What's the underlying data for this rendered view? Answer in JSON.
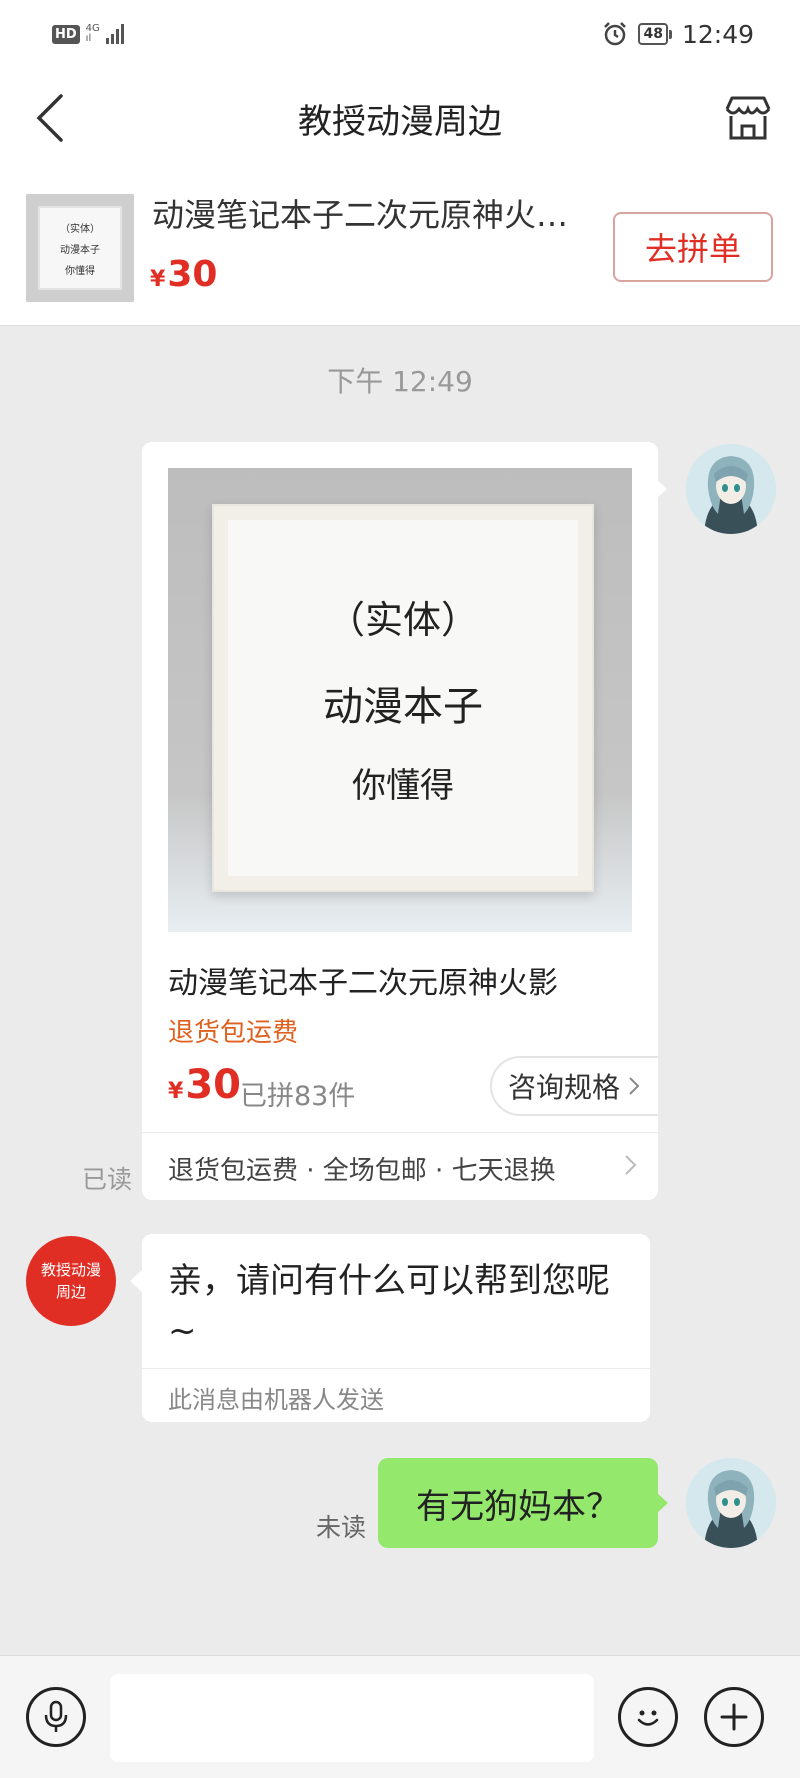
{
  "status_bar": {
    "hd": "HD",
    "network": "4G",
    "battery": "48",
    "time": "12:49"
  },
  "nav": {
    "title": "教授动漫周边"
  },
  "product_strip": {
    "title": "动漫笔记本子二次元原神火…",
    "currency": "¥",
    "price": "30",
    "button_label": "去拼单",
    "thumb_lines": [
      "（实体）",
      "动漫本子",
      "你懂得"
    ]
  },
  "chat": {
    "timestamp": "下午 12:49",
    "product_card": {
      "image_lines": [
        "（实体）",
        "动漫本子",
        "你懂得"
      ],
      "title": "动漫笔记本子二次元原神火影",
      "promo": "退货包运费",
      "currency": "¥",
      "price": "30",
      "sold": "已拼83件",
      "consult_label": "咨询规格",
      "services": "退货包运费 · 全场包邮 · 七天退换"
    },
    "read_status": "已读",
    "shop_avatar_text": "教授动漫周边",
    "bot_message": {
      "text": "亲，请问有什么可以帮到您呢~",
      "footnote": "此消息由机器人发送"
    },
    "unread_status": "未读",
    "my_message": "有无狗妈本？"
  },
  "input": {
    "placeholder": ""
  },
  "colors": {
    "brand_red": "#e02e24",
    "my_bubble": "#94e86c",
    "promo_orange": "#e0611f"
  }
}
